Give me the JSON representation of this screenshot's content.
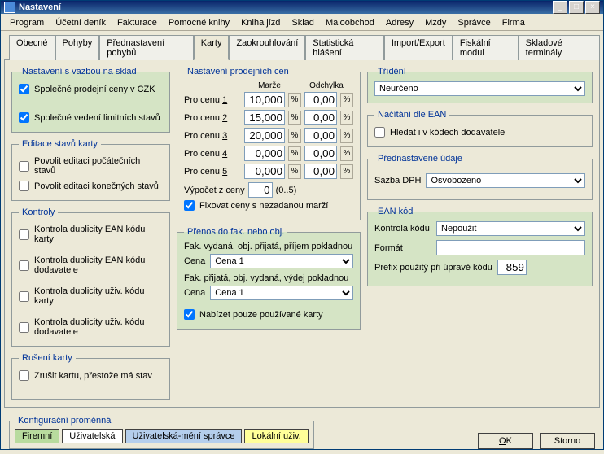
{
  "window": {
    "title": "Nastavení"
  },
  "menubar": [
    "Program",
    "Účetní deník",
    "Fakturace",
    "Pomocné knihy",
    "Kniha jízd",
    "Sklad",
    "Maloobchod",
    "Adresy",
    "Mzdy",
    "Správce",
    "Firma"
  ],
  "tabs": [
    "Obecné",
    "Pohyby",
    "Přednastavení pohybů",
    "Karty",
    "Zaokrouhlování",
    "Statistická hlášení",
    "Import/Export",
    "Fiskální modul",
    "Skladové terminály"
  ],
  "active_tab": 3,
  "sklad_link": {
    "legend": "Nastavení s vazbou na sklad",
    "common_prices": {
      "label": "Společné prodejní ceny v CZK",
      "checked": true
    },
    "common_limits": {
      "label": "Společné vedení limitních stavů",
      "checked": true
    }
  },
  "edit_states": {
    "legend": "Editace stavů karty",
    "initial": {
      "label": "Povolit editaci počátečních stavů",
      "checked": false
    },
    "final": {
      "label": "Povolit editaci konečných stavů",
      "checked": false
    }
  },
  "controls": {
    "legend": "Kontroly",
    "ean_card": {
      "label": "Kontrola duplicity EAN kódu karty",
      "checked": false
    },
    "ean_supplier": {
      "label": "Kontrola duplicity EAN kódu dodavatele",
      "checked": false
    },
    "user_card": {
      "label": "Kontrola duplicity uživ. kódu karty",
      "checked": false
    },
    "user_supplier": {
      "label": "Kontrola duplicity uživ. kódu dodavatele",
      "checked": false
    }
  },
  "cancel_card": {
    "legend": "Rušení karty",
    "label": "Zrušit kartu, přestože má stav",
    "checked": false
  },
  "prices": {
    "legend": "Nastavení prodejních cen",
    "header_margin": "Marže",
    "header_dev": "Odchylka",
    "rows": [
      {
        "label_pre": "Pro cenu ",
        "label_u": "1",
        "margin": "10,000",
        "dev": "0,00"
      },
      {
        "label_pre": "Pro cenu ",
        "label_u": "2",
        "margin": "15,000",
        "dev": "0,00"
      },
      {
        "label_pre": "Pro cenu ",
        "label_u": "3",
        "margin": "20,000",
        "dev": "0,00"
      },
      {
        "label_pre": "Pro cenu ",
        "label_u": "4",
        "margin": "0,000",
        "dev": "0,00"
      },
      {
        "label_pre": "Pro cenu ",
        "label_u": "5",
        "margin": "0,000",
        "dev": "0,00"
      }
    ],
    "calc_label": "Výpočet z ceny",
    "calc_value": "0",
    "calc_hint": "(0..5)",
    "fix_label": "Fixovat ceny s nezadanou marží",
    "fix_checked": true
  },
  "transfer": {
    "legend": "Přenos do fak. nebo obj.",
    "row1_label": "Fak. vydaná, obj. přijatá, příjem pokladnou",
    "row2_label": "Fak. přijatá, obj. vydaná, výdej pokladnou",
    "cena": "Cena",
    "sel1": "Cena 1",
    "sel2": "Cena 1",
    "offer_label": "Nabízet pouze používané karty",
    "offer_checked": true
  },
  "sorting": {
    "legend": "Třídění",
    "value": "Neurčeno"
  },
  "ean_read": {
    "legend": "Načítání dle EAN",
    "label": "Hledat i v kódech dodavatele",
    "checked": false
  },
  "preset": {
    "legend": "Přednastavené údaje",
    "vat_label": "Sazba DPH",
    "vat_value": "Osvobozeno"
  },
  "ean_code": {
    "legend": "EAN kód",
    "check_label": "Kontrola kódu",
    "check_value": "Nepoužit",
    "format_label": "Formát",
    "format_value": "",
    "prefix_label": "Prefix použitý při úpravě kódu",
    "prefix_value": "859"
  },
  "config": {
    "legend": "Konfigurační proměnná",
    "btns": [
      "Firemní",
      "Uživatelská",
      "Uživatelská-mění správce",
      "Lokální uživ."
    ]
  },
  "buttons": {
    "ok": "OK",
    "cancel": "Storno"
  },
  "pct": "%"
}
